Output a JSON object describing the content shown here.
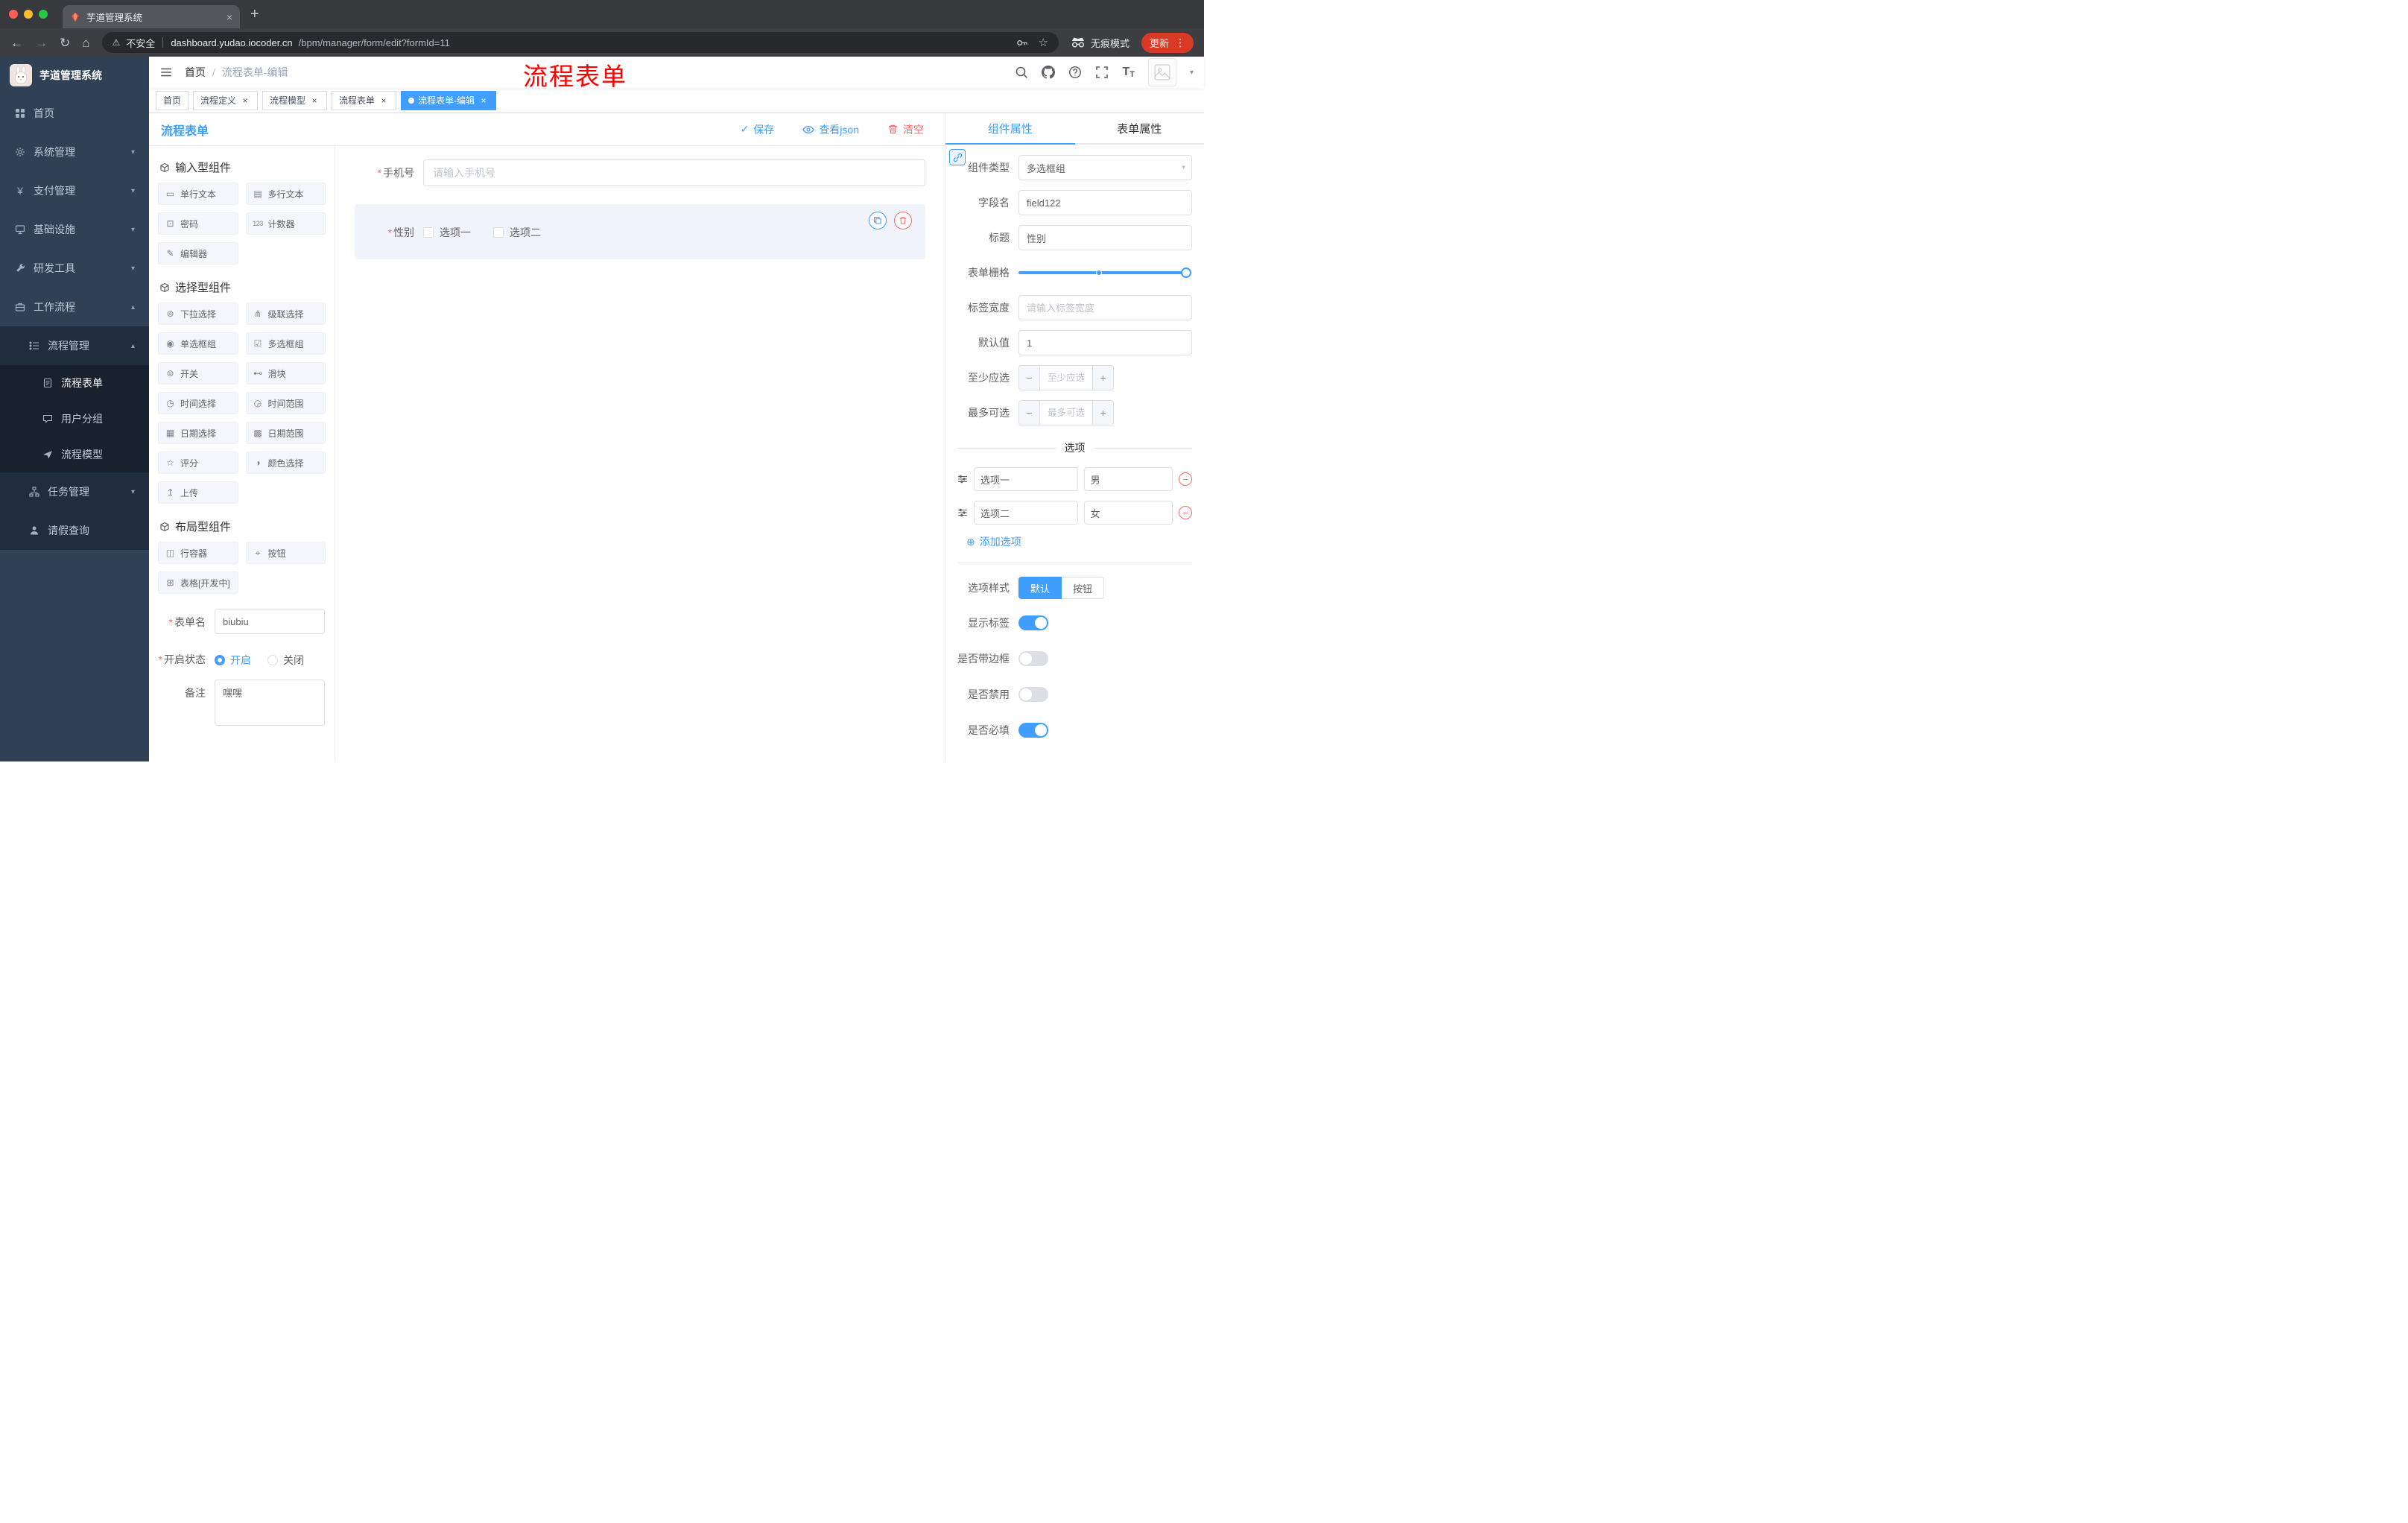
{
  "browser": {
    "tab": {
      "title": "芋道管理系统"
    },
    "address": {
      "security": "不安全",
      "url_domain": "dashboard.yudao.iocoder.cn",
      "url_path": "/bpm/manager/form/edit?formId=11",
      "incognito": "无痕模式",
      "update": "更新"
    }
  },
  "icons": {
    "close": "×",
    "plus": "+",
    "back": "←",
    "forward": "→",
    "reload": "↻",
    "home": "⌂",
    "warning": "⚠",
    "star": "☆",
    "menu_dots": "⋮",
    "caret_down": "▾",
    "caret_up": "▴",
    "yen": "¥",
    "breadcrumb_sep": "/",
    "check": "✓",
    "required": "*",
    "minus": "−",
    "plus_small": "+",
    "add_circle": "⊕"
  },
  "sidebar": {
    "title": "芋道管理系统",
    "items": [
      {
        "label": "首页"
      },
      {
        "label": "系统管理"
      },
      {
        "label": "支付管理"
      },
      {
        "label": "基础设施"
      },
      {
        "label": "研发工具"
      },
      {
        "label": "工作流程"
      }
    ],
    "workflow": {
      "process_mgmt": "流程管理",
      "process_children": [
        {
          "label": "流程表单"
        },
        {
          "label": "用户分组"
        },
        {
          "label": "流程模型"
        }
      ],
      "task_mgmt": "任务管理",
      "leave_query": "请假查询"
    }
  },
  "navbar": {
    "breadcrumb": [
      "首页",
      "流程表单-编辑"
    ],
    "annotation": "流程表单"
  },
  "tags": [
    {
      "label": "首页"
    },
    {
      "label": "流程定义"
    },
    {
      "label": "流程模型"
    },
    {
      "label": "流程表单"
    },
    {
      "label": "流程表单-编辑"
    }
  ],
  "editor": {
    "title": "流程表单",
    "actions": {
      "save": "保存",
      "view_json": "查看json",
      "clear": "清空"
    }
  },
  "palette": {
    "groups": [
      {
        "title": "输入型组件",
        "items": [
          {
            "label": "单行文本",
            "icon": "▭"
          },
          {
            "label": "多行文本",
            "icon": "▤"
          },
          {
            "label": "密码",
            "icon": "⊡"
          },
          {
            "label": "计数器",
            "icon": "123"
          },
          {
            "label": "编辑器",
            "icon": "✎"
          }
        ]
      },
      {
        "title": "选择型组件",
        "items": [
          {
            "label": "下拉选择",
            "icon": "⊚"
          },
          {
            "label": "级联选择",
            "icon": "⋔"
          },
          {
            "label": "单选框组",
            "icon": "◉"
          },
          {
            "label": "多选框组",
            "icon": "☑"
          },
          {
            "label": "开关",
            "icon": "⊜"
          },
          {
            "label": "滑块",
            "icon": "⊷"
          },
          {
            "label": "时间选择",
            "icon": "◷"
          },
          {
            "label": "时间范围",
            "icon": "◶"
          },
          {
            "label": "日期选择",
            "icon": "▦"
          },
          {
            "label": "日期范围",
            "icon": "▩"
          },
          {
            "label": "评分",
            "icon": "☆"
          },
          {
            "label": "颜色选择",
            "icon": "◑"
          },
          {
            "label": "上传",
            "icon": "↥"
          }
        ]
      },
      {
        "title": "布局型组件",
        "items": [
          {
            "label": "行容器",
            "icon": "◫"
          },
          {
            "label": "按钮",
            "icon": "⌖"
          },
          {
            "label": "表格[开发中]",
            "icon": "⊞"
          }
        ]
      }
    ],
    "form": {
      "name_label": "表单名",
      "name_value": "biubiu",
      "status_label": "开启状态",
      "status_on": "开启",
      "status_off": "关闭",
      "remark_label": "备注",
      "remark_value": "嘿嘿"
    }
  },
  "canvas": {
    "phone": {
      "label": "手机号",
      "placeholder": "请输入手机号"
    },
    "gender": {
      "label": "性别",
      "options": [
        "选项一",
        "选项二"
      ]
    }
  },
  "props": {
    "tabs": [
      "组件属性",
      "表单属性"
    ],
    "component_type_label": "组件类型",
    "component_type_value": "多选框组",
    "field_name_label": "字段名",
    "field_name_value": "field122",
    "title_label": "标题",
    "title_value": "性别",
    "grid_label": "表单栅格",
    "label_width_label": "标签宽度",
    "label_width_placeholder": "请输入标签宽度",
    "default_label": "默认值",
    "default_value": "1",
    "min_label": "至少应选",
    "min_placeholder": "至少应选",
    "max_label": "最多可选",
    "max_placeholder": "最多可选",
    "options_divider": "选项",
    "options": [
      {
        "label": "选项一",
        "value": "男"
      },
      {
        "label": "选项二",
        "value": "女"
      }
    ],
    "add_option": "添加选项",
    "style_label": "选项样式",
    "style_default": "默认",
    "style_button": "按钮",
    "toggles": [
      {
        "label": "显示标签"
      },
      {
        "label": "是否带边框"
      },
      {
        "label": "是否禁用"
      },
      {
        "label": "是否必填"
      }
    ]
  },
  "colors": {
    "primary": "#409EFF",
    "danger": "#F56C6C",
    "sidebar_bg": "#304156",
    "sidebar_sub_bg": "#1F2D3D",
    "annotation_red": "#FF0000"
  }
}
